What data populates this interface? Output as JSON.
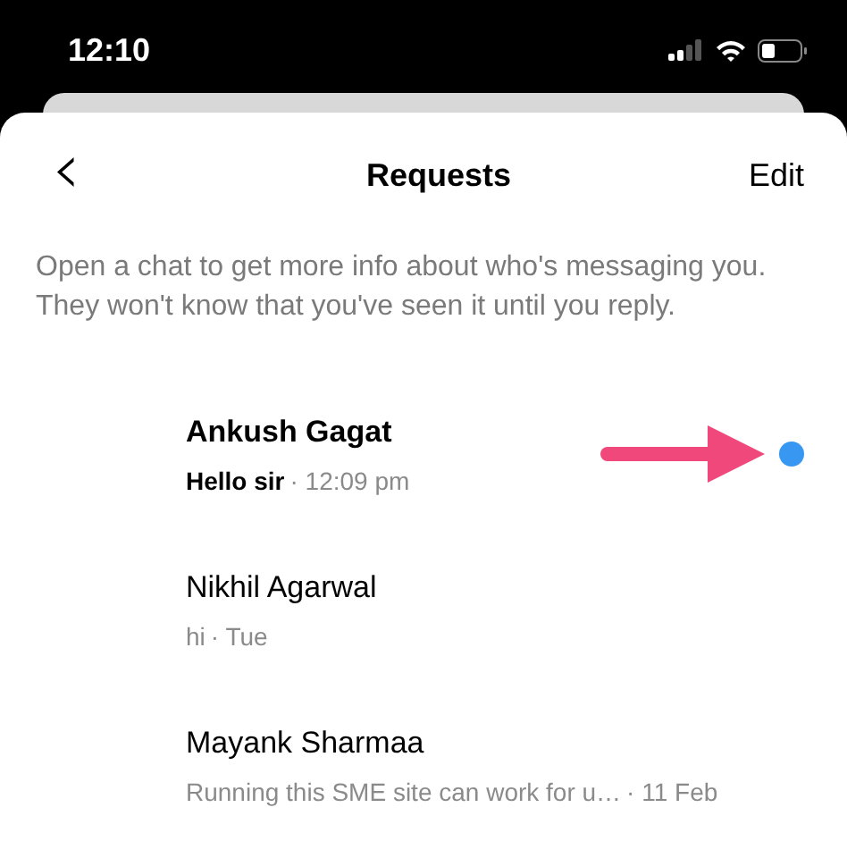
{
  "status_bar": {
    "time": "12:10"
  },
  "nav": {
    "back": "‹",
    "title": "Requests",
    "action": "Edit"
  },
  "notice": "Open a chat to get more info about who's messaging you. They won't know that you've seen it until you reply.",
  "requests": [
    {
      "name": "Ankush Gagat",
      "message": "Hello sir",
      "time": "· 12:09 pm",
      "unread": true
    },
    {
      "name": "Nikhil Agarwal",
      "message": "hi",
      "time": "· Tue",
      "unread": false
    },
    {
      "name": "Mayank Sharmaa",
      "message": "Running this SME site can work for u…",
      "time": "· 11 Feb",
      "unread": false
    }
  ]
}
